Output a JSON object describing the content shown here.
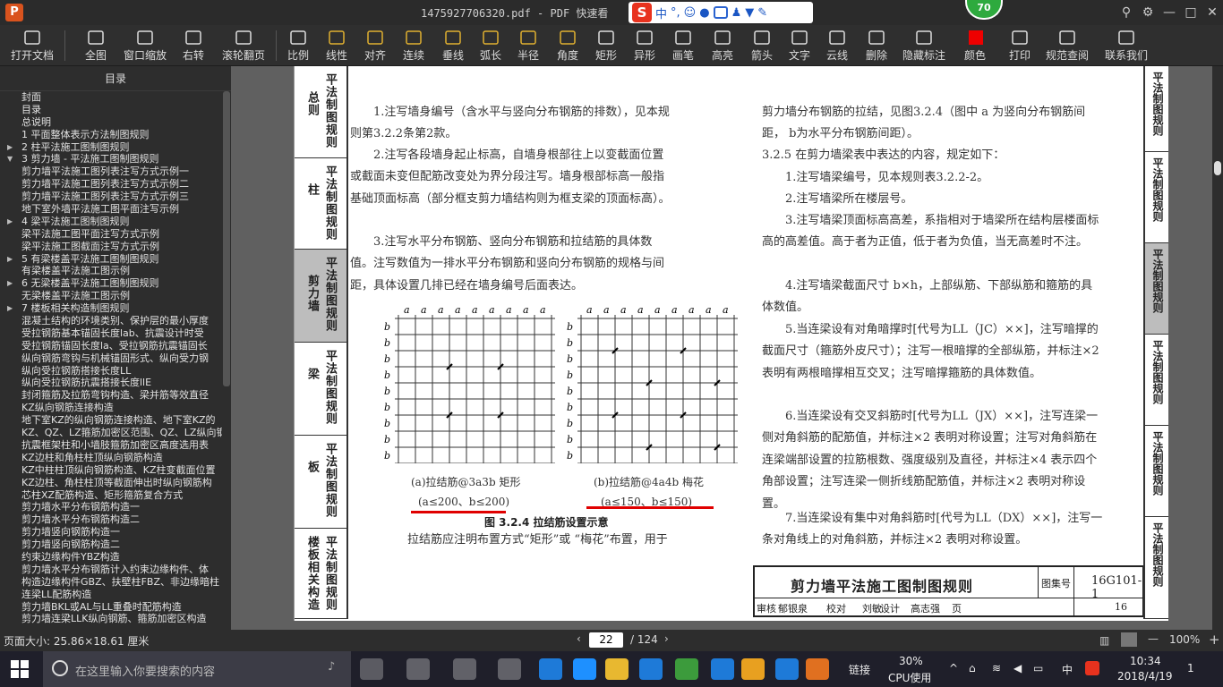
{
  "window": {
    "title": "1475927706320.pdf - PDF 快速看",
    "logo": "P",
    "min": "—",
    "max": "□",
    "close": "✕"
  },
  "ime": {
    "s": "S",
    "lang": "中",
    "punct": "°,"
  },
  "badge": {
    "value": "70"
  },
  "toolbar": [
    "打开文档",
    "全图",
    "窗口缩放",
    "右转",
    "滚轮翻页",
    "比例",
    "线性",
    "对齐",
    "连续",
    "垂线",
    "弧长",
    "半径",
    "角度",
    "矩形",
    "异形",
    "画笔",
    "高亮",
    "箭头",
    "文字",
    "云线",
    "删除",
    "隐藏标注",
    "颜色",
    "打印",
    "规范查阅",
    "联系我们"
  ],
  "toc": {
    "header": "目录",
    "items": [
      {
        "t": "封面",
        "a": ""
      },
      {
        "t": "目录",
        "a": ""
      },
      {
        "t": "总说明",
        "a": ""
      },
      {
        "t": "1 平面整体表示方法制图规则",
        "a": ""
      },
      {
        "t": "2 柱平法施工图制图规则",
        "a": "▶"
      },
      {
        "t": "3 剪力墙 - 平法施工图制图规则",
        "a": "▼"
      },
      {
        "t": "剪力墙平法施工图列表注写方式示例一",
        "a": ""
      },
      {
        "t": "剪力墙平法施工图列表注写方式示例二",
        "a": ""
      },
      {
        "t": "剪力墙平法施工图列表注写方式示例三",
        "a": ""
      },
      {
        "t": "地下室外墙平法施工图平面注写示例",
        "a": ""
      },
      {
        "t": "4 梁平法施工图制图规则",
        "a": "▶"
      },
      {
        "t": "梁平法施工图平面注写方式示例",
        "a": ""
      },
      {
        "t": "梁平法施工图截面注写方式示例",
        "a": ""
      },
      {
        "t": "5 有梁楼盖平法施工图制图规则",
        "a": "▶"
      },
      {
        "t": "有梁楼盖平法施工图示例",
        "a": ""
      },
      {
        "t": "6 无梁楼盖平法施工图制图规则",
        "a": "▶"
      },
      {
        "t": "无梁楼盖平法施工图示例",
        "a": ""
      },
      {
        "t": "7 楼板相关构造制图规则",
        "a": "▶"
      },
      {
        "t": "混凝土结构的环境类别、保护层的最小厚度",
        "a": ""
      },
      {
        "t": "受拉钢筋基本锚固长度lab、抗震设计时受",
        "a": ""
      },
      {
        "t": "受拉钢筋锚固长度la、受拉钢筋抗震锚固长",
        "a": ""
      },
      {
        "t": "纵向钢筋弯钩与机械锚固形式、纵向受力钢",
        "a": ""
      },
      {
        "t": "纵向受拉钢筋搭接长度LL",
        "a": ""
      },
      {
        "t": "纵向受拉钢筋抗震搭接长度llE",
        "a": ""
      },
      {
        "t": "封闭箍筋及拉筋弯钩构造、梁并筋等效直径",
        "a": ""
      },
      {
        "t": "KZ纵向钢筋连接构造",
        "a": ""
      },
      {
        "t": "地下室KZ的纵向钢筋连接构造、地下室KZ的",
        "a": ""
      },
      {
        "t": "KZ、QZ、LZ箍筋加密区范围、QZ、LZ纵向钢",
        "a": ""
      },
      {
        "t": "抗震框架柱和小墙肢箍筋加密区高度选用表",
        "a": ""
      },
      {
        "t": "KZ边柱和角柱柱顶纵向钢筋构造",
        "a": ""
      },
      {
        "t": "KZ中柱柱顶纵向钢筋构造、KZ柱变截面位置",
        "a": ""
      },
      {
        "t": "KZ边柱、角柱柱顶等截面伸出时纵向钢筋构",
        "a": ""
      },
      {
        "t": "芯柱XZ配筋构造、矩形箍筋复合方式",
        "a": ""
      },
      {
        "t": "剪力墙水平分布钢筋构造一",
        "a": ""
      },
      {
        "t": "剪力墙水平分布钢筋构造二",
        "a": ""
      },
      {
        "t": "剪力墙竖向钢筋构造一",
        "a": ""
      },
      {
        "t": "剪力墙竖向钢筋构造二",
        "a": ""
      },
      {
        "t": "约束边缘构件YBZ构造",
        "a": ""
      },
      {
        "t": "剪力墙水平分布钢筋计入约束边缘构件、体",
        "a": ""
      },
      {
        "t": "构造边缘构件GBZ、扶壁柱FBZ、非边缘暗柱",
        "a": ""
      },
      {
        "t": "连梁LL配筋构造",
        "a": ""
      },
      {
        "t": "剪力墙BKL或AL与LL重叠时配筋构造",
        "a": ""
      },
      {
        "t": "剪力墙连梁LLK纵向钢筋、箍筋加密区构造",
        "a": ""
      }
    ]
  },
  "page": {
    "lefttabs": [
      {
        "a": "总则",
        "b": "平法制图规则"
      },
      {
        "a": "柱",
        "b": "平法制图规则"
      },
      {
        "a": "剪力墙",
        "b": "平法制图规则"
      },
      {
        "a": "梁",
        "b": "平法制图规则"
      },
      {
        "a": "板",
        "b": "平法制图规则"
      },
      {
        "a": "楼板相关构造",
        "b": "平法制图规则"
      }
    ],
    "righttabs": [
      "平法制图规则",
      "平法制图规则",
      "平法制图规则",
      "平法制图规则",
      "平法制图规则",
      "平法制图规则"
    ],
    "left_paras": [
      "1.注写墙身编号（含水平与竖向分布钢筋的排数），见本规则第3.2.2条第2款。",
      "2.注写各段墙身起止标高，自墙身根部往上以变截面位置或截面未变但配筋改变处为界分段注写。墙身根部标高一般指基础顶面标高（部分框支剪力墙结构则为框支梁的顶面标高）。",
      "3.注写水平分布钢筋、竖向分布钢筋和拉结筋的具体数值。注写数值为一排水平分布钢筋和竖向分布钢筋的规格与间距，具体设置几排已经在墙身编号后面表达。"
    ],
    "cap_a1": "(a)拉结筋@3a3b 矩形",
    "cap_a2": "(a≤200、b≤200)",
    "cap_b1": "(b)拉结筋@4a4b 梅花",
    "cap_b2": "(a≤150、b≤150)",
    "figcap": "图 3.2.4 拉结筋设置示意",
    "after_fig": "拉结筋应注明布置方式“矩形”或 “梅花”布置，用于",
    "right_paras": [
      "剪力墙分布钢筋的拉结，见图3.2.4（图中 a 为竖向分布钢筋间距， b为水平分布钢筋间距）。",
      "3.2.5 在剪力墙梁表中表达的内容，规定如下：",
      "1.注写墙梁编号，见本规则表3.2.2-2。",
      "2.注写墙梁所在楼层号。",
      "3.注写墙梁顶面标高高差，系指相对于墙梁所在结构层楼面标高的高差值。高于者为正值，低于者为负值，当无高差时不注。",
      "4.注写墙梁截面尺寸 b×h，上部纵筋、下部纵筋和箍筋的具体数值。",
      "5.当连梁设有对角暗撑时[代号为LL（JC）××]，注写暗撑的截面尺寸（箍筋外皮尺寸）；注写一根暗撑的全部纵筋，并标注×2 表明有两根暗撑相互交叉；注写暗撑箍筋的具体数值。",
      "6.当连梁设有交叉斜筋时[代号为LL（JX）××]，注写连梁一侧对角斜筋的配筋值，并标注×2 表明对称设置；注写对角斜筋在连梁端部设置的拉筋根数、强度级别及直径，并标注×4 表示四个角部设置；注写连梁一侧折线筋配筋值，并标注×2 表明对称设置。",
      "7.当连梁设有集中对角斜筋时[代号为LL（DX）××]，注写一条对角线上的对角斜筋，并标注×2 表明对称设置。"
    ],
    "footer": {
      "title": "剪力墙平法施工图制图规则",
      "set_label": "图集号",
      "set_no": "16G101-1",
      "row": [
        "审核",
        "郁银泉",
        "校对",
        "刘敏",
        "设计",
        "高志强",
        "页",
        "16"
      ]
    },
    "grid_a": "a",
    "grid_b": "b"
  },
  "status": {
    "pagesize": "页面大小: 25.86×18.61 厘米",
    "page": "22",
    "total": "/ 124",
    "zoom": "100%"
  },
  "taskbar": {
    "search": "在这里输入你要搜索的内容",
    "link": "链接",
    "cpu": "30%",
    "cpu_label": "CPU使用",
    "lang": "中",
    "time": "10:34",
    "date": "2018/4/19",
    "notif": "1"
  }
}
